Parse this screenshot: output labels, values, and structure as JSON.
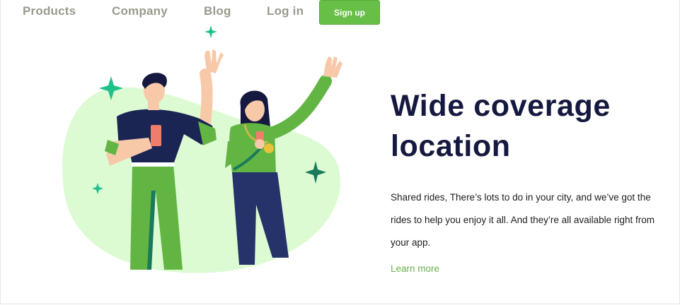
{
  "nav": {
    "products": "Products",
    "company": "Company",
    "blog": "Blog",
    "login": "Log in",
    "signup": "Sign up"
  },
  "hero": {
    "title_line1": "Wide coverage",
    "title_line2": "location",
    "body": "Shared rides, There’s lots to do in your city, and we’ve got the rides to help you enjoy it all. And they’re all available right from your app.",
    "cta": "Learn more"
  },
  "colors": {
    "accent": "#68bf48",
    "heading": "#16193f",
    "nav_text": "#9a9a8e",
    "blob": "#dcfbd3",
    "sparkle": "#1fc08a"
  },
  "illustration": {
    "icons": [
      "sparkle-icon",
      "man-figure",
      "woman-figure",
      "phone-icon",
      "medal-icon"
    ]
  }
}
